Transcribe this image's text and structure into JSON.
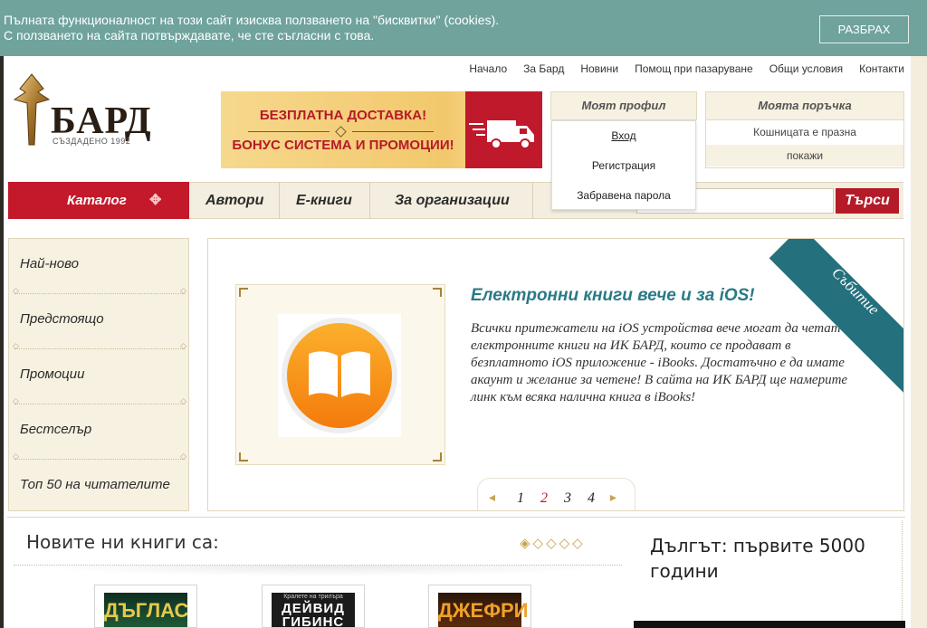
{
  "cookie": {
    "line1": "Пълната функционалност на този сайт изисква ползването на \"бисквитки\" (cookies).",
    "line2": "С ползването на сайта потвърждавате, че сте съгласни с това.",
    "button": "РАЗБРАХ"
  },
  "top_nav": [
    "Начало",
    "За Бард",
    "Новини",
    "Помощ при пазаруване",
    "Общи условия",
    "Контакти"
  ],
  "logo": {
    "name": "БАРД",
    "tagline": "СЪЗДАДЕНО 1992"
  },
  "banner": {
    "line1": "БЕЗПЛАТНА ДОСТАВКА!",
    "line2": "БОНУС СИСТЕМА И ПРОМОЦИИ!"
  },
  "profile": {
    "title": "Моят профил",
    "items": [
      "Вход",
      "Регистрация",
      "Забравена парола"
    ]
  },
  "order": {
    "title": "Моята поръчка",
    "status": "Кошницата е празна",
    "show": "покажи"
  },
  "menu": {
    "catalog": "Каталог",
    "authors": "Автори",
    "ebooks": "Е-книги",
    "orgs": "За организации"
  },
  "search": {
    "value": "",
    "button": "Търси"
  },
  "sidebar": {
    "items": [
      "Най-ново",
      "Предстоящо",
      "Промоции",
      "Бестселър",
      "Топ 50 на читателите"
    ]
  },
  "slide": {
    "title": "Електронни книги вече и за iOS!",
    "text": "Всички притежатели на iOS устройства вече могат да четат електронните книги на ИК БАРД, които се продават в безплатното iOS приложение - iBooks. Достатъчно е да имате акаунт и желание за четене! В сайта на ИК БАРД ще намерите линк към всяка налична книга в iBooks!",
    "ribbon": "Събитие",
    "pages": [
      "1",
      "2",
      "3",
      "4"
    ],
    "active_page": "2"
  },
  "new_books": {
    "title": "Новите ни книги са:",
    "covers": [
      {
        "line1": "ДЪГЛАС"
      },
      {
        "small": "Кралете на трилъра",
        "line1": "ДЕЙВИД",
        "line2": "ГИБИНС"
      },
      {
        "line1": "ДЖЕФРИ"
      }
    ]
  },
  "right_box": {
    "title": "Дългът: първите 5000 години"
  },
  "colors": {
    "teal": "#6fa39c",
    "red": "#c3192a",
    "cream": "#f6f1e1",
    "ribbon": "#24707d"
  }
}
